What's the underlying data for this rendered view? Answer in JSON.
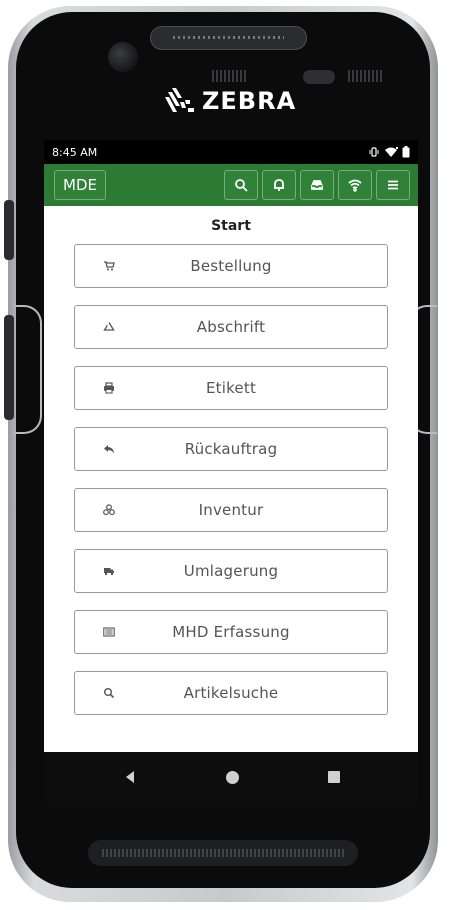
{
  "device": {
    "brand": "ZEBRA",
    "icon_names": [
      "camera",
      "speaker-grille",
      "brand-logo"
    ]
  },
  "status_bar": {
    "time": "8:45 AM",
    "icons": [
      "vibrate-icon",
      "wifi-icon",
      "battery-icon"
    ]
  },
  "app_bar": {
    "title_button": "MDE",
    "actions": [
      {
        "name": "search-icon"
      },
      {
        "name": "bell-icon"
      },
      {
        "name": "inbox-icon"
      },
      {
        "name": "wifi-icon"
      },
      {
        "name": "menu-icon"
      }
    ],
    "color": "#2c7a33"
  },
  "page": {
    "title": "Start"
  },
  "menu": [
    {
      "label": "Bestellung",
      "icon": "cart-icon"
    },
    {
      "label": "Abschrift",
      "icon": "recycle-icon"
    },
    {
      "label": "Etikett",
      "icon": "print-icon"
    },
    {
      "label": "Rückauftrag",
      "icon": "reply-icon"
    },
    {
      "label": "Inventur",
      "icon": "boxes-icon"
    },
    {
      "label": "Umlagerung",
      "icon": "truck-icon"
    },
    {
      "label": "MHD Erfassung",
      "icon": "list-icon"
    },
    {
      "label": "Artikelsuche",
      "icon": "search-icon"
    }
  ],
  "nav_bar": {
    "buttons": [
      "back-icon",
      "home-icon",
      "recent-apps-icon"
    ]
  }
}
